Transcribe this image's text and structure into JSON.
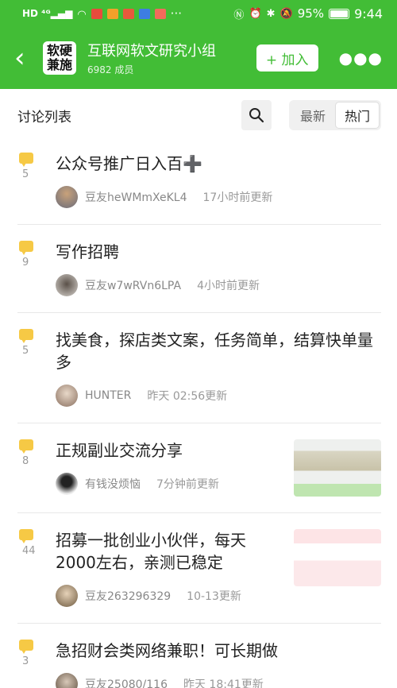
{
  "status": {
    "time": "9:44",
    "battery": "95%"
  },
  "group": {
    "logo_line1": "软硬",
    "logo_line2": "兼施",
    "name": "互联网软文研究小组",
    "members": "6982 成员",
    "join_label": "+ 加入"
  },
  "list": {
    "title": "讨论列表",
    "sort_latest": "最新",
    "sort_hot": "热门"
  },
  "topics": [
    {
      "count": "5",
      "title": "公众号推广日入百➕",
      "author": "豆友heWMmXeKL4",
      "time": "17小时前更新"
    },
    {
      "count": "9",
      "title": "写作招聘",
      "author": "豆友w7wRVn6LPA",
      "time": "4小时前更新"
    },
    {
      "count": "5",
      "title": "找美食，探店类文案，任务简单，结算快单量多",
      "author": "HUNTER",
      "time": "昨天 02:56更新"
    },
    {
      "count": "8",
      "title": "正规副业交流分享",
      "author": "有钱没烦恼",
      "time": "7分钟前更新"
    },
    {
      "count": "44",
      "title": "招募一批创业小伙伴，每天2000左右，亲测已稳定",
      "author": "豆友263296329",
      "time": "10-13更新"
    },
    {
      "count": "3",
      "title": "急招财会类网络兼职！可长期做",
      "author": "豆友25080/116",
      "time": "昨天 18:41更新"
    }
  ]
}
